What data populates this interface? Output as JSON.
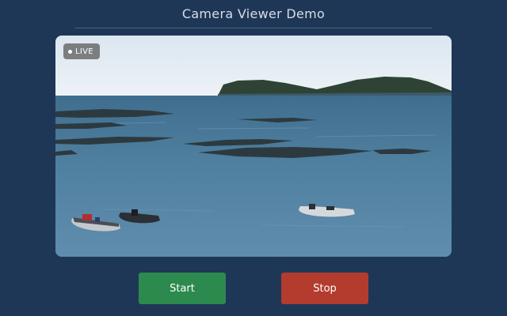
{
  "app": {
    "title": "Camera Viewer Demo"
  },
  "viewer": {
    "badge_label": "LIVE",
    "scene_icon": "coastal-camera-feed"
  },
  "controls": {
    "start_label": "Start",
    "stop_label": "Stop"
  },
  "colors": {
    "background": "#1f3756",
    "start": "#2d8a4e",
    "stop": "#b43c2f",
    "divider": "#4a617f"
  }
}
